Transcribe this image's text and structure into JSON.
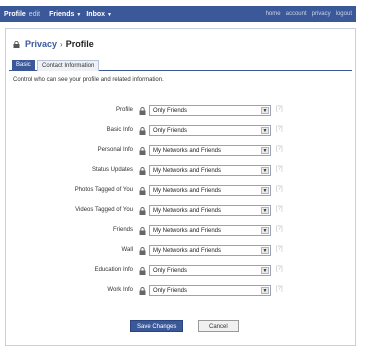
{
  "topbar": {
    "profile": "Profile",
    "edit": "edit",
    "friends": "Friends",
    "inbox": "Inbox",
    "home": "home",
    "account": "account",
    "privacy": "privacy",
    "logout": "logout"
  },
  "breadcrumb": {
    "privacy": "Privacy",
    "separator": "›",
    "profile": "Profile"
  },
  "tabs": {
    "basic": "Basic",
    "contact": "Contact Information"
  },
  "description": "Control who can see your profile and related information.",
  "settings": [
    {
      "label": "Profile",
      "value": "Only Friends"
    },
    {
      "label": "Basic Info",
      "value": "Only Friends"
    },
    {
      "label": "Personal Info",
      "value": "My Networks and Friends"
    },
    {
      "label": "Status Updates",
      "value": "My Networks and Friends"
    },
    {
      "label": "Photos Tagged of You",
      "value": "My Networks and Friends"
    },
    {
      "label": "Videos Tagged of You",
      "value": "My Networks and Friends"
    },
    {
      "label": "Friends",
      "value": "My Networks and Friends"
    },
    {
      "label": "Wall",
      "value": "My Networks and Friends"
    },
    {
      "label": "Education Info",
      "value": "Only Friends"
    },
    {
      "label": "Work Info",
      "value": "Only Friends"
    }
  ],
  "help_glyph": "[?]",
  "buttons": {
    "save": "Save Changes",
    "cancel": "Cancel"
  },
  "colors": {
    "brand": "#3b5998",
    "panel_border": "#c9cfdc"
  }
}
